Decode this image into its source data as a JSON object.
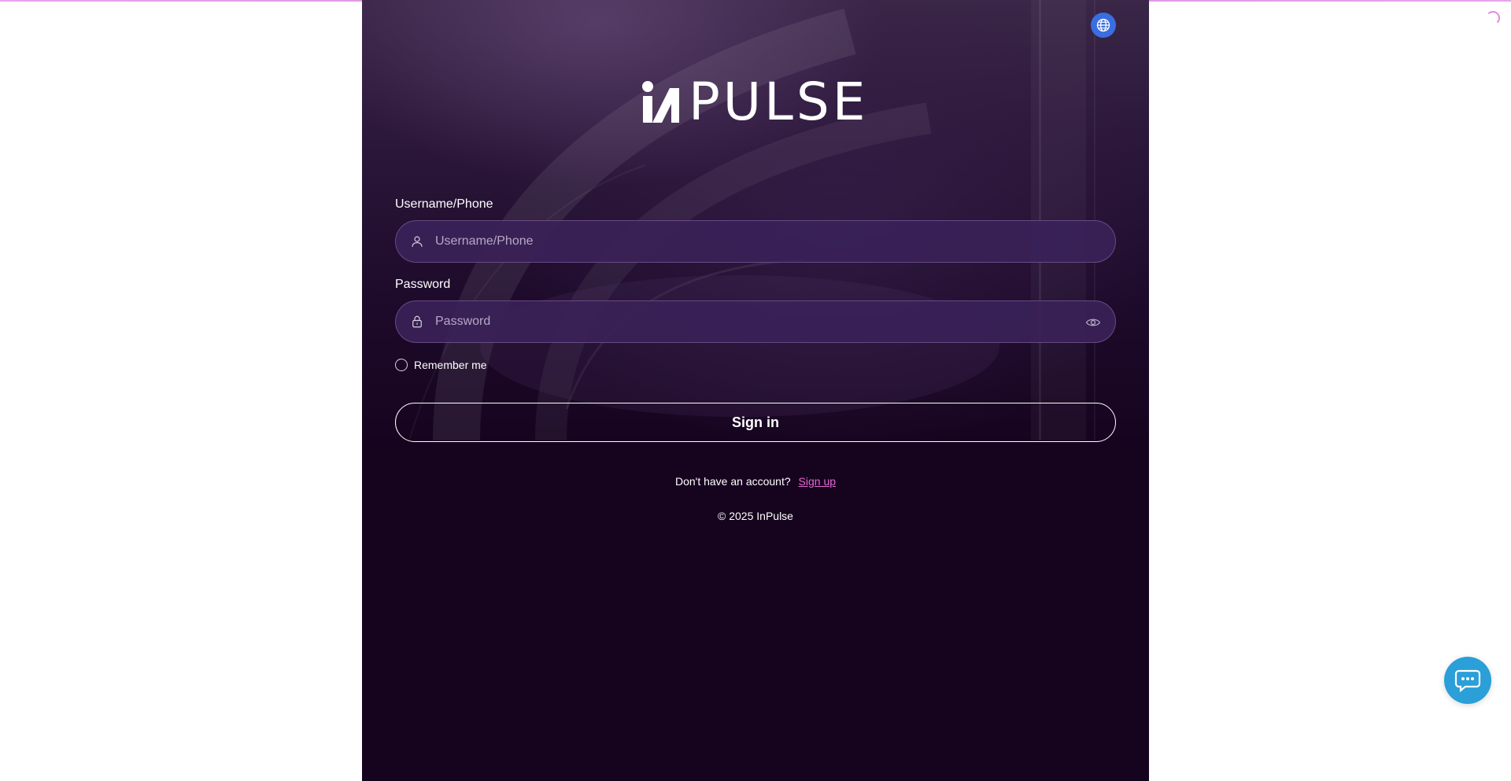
{
  "brand": {
    "logo_text": "PULSE",
    "accent_color": "#e467d3",
    "panel_color": "#16041f",
    "language_button_color": "#3a6ee0",
    "chat_button_color": "#2a9fd8"
  },
  "header": {
    "language_icon": "globe-icon"
  },
  "form": {
    "username": {
      "label": "Username/Phone",
      "placeholder": "Username/Phone",
      "value": "",
      "icon": "user-icon"
    },
    "password": {
      "label": "Password",
      "placeholder": "Password",
      "value": "",
      "icon": "lock-icon",
      "toggle_icon": "eye-icon"
    },
    "remember_label": "Remember me",
    "signin_label": "Sign in"
  },
  "footer": {
    "no_account_text": "Don't have an account?",
    "signup_label": "Sign up",
    "copyright": "© 2025 InPulse"
  },
  "widgets": {
    "chat_icon": "chat-bubble-icon"
  }
}
